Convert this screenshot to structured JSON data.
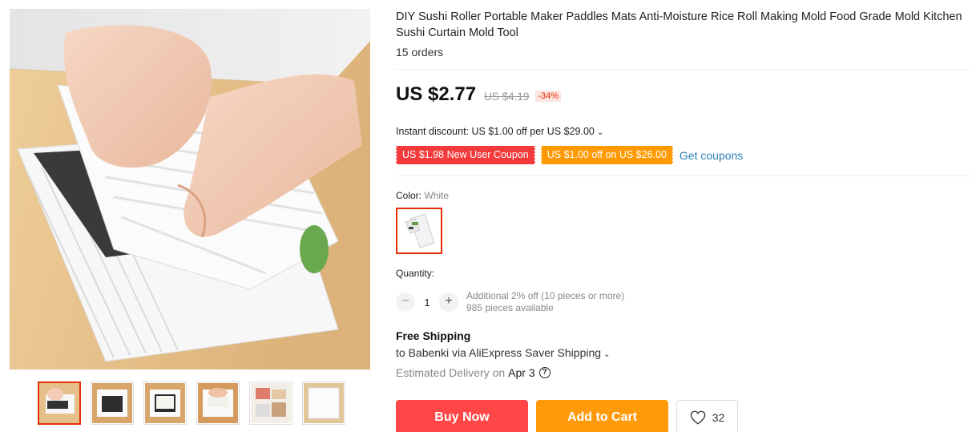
{
  "product": {
    "title": "DIY Sushi Roller Portable Maker Paddles Mats Anti-Moisture Rice Roll Making Mold Food Grade Mold Kitchen Sushi Curtain Mold Tool",
    "orders": "15 orders"
  },
  "price": {
    "current": "US $2.77",
    "original": "US $4.19",
    "discount": "-34%"
  },
  "instant_discount": "Instant discount: US $1.00 off per US $29.00",
  "coupons": {
    "new_user": "US $1.98 New User Coupon",
    "store": "US $1.00 off on US $26.00",
    "get_link": "Get coupons"
  },
  "color": {
    "label": "Color:",
    "selected": "White"
  },
  "quantity": {
    "label": "Quantity:",
    "minus": "−",
    "value": "1",
    "plus": "+",
    "note_line1": "Additional 2% off (10 pieces or more)",
    "note_line2": "985 pieces available"
  },
  "shipping": {
    "title": "Free Shipping",
    "to": "to Babenki via AliExpress Saver Shipping",
    "estimated_label": "Estimated Delivery on",
    "estimated_date": "Apr 3",
    "help_glyph": "?"
  },
  "actions": {
    "buy": "Buy Now",
    "cart": "Add to Cart",
    "wishlist_count": "32"
  },
  "icons": {
    "chevron": "chevron-down-icon",
    "heart": "heart-icon",
    "help": "question-circle-icon"
  },
  "colors": {
    "accent_red": "#ff4747",
    "accent_orange": "#ff9a0b",
    "link_blue": "#2e7fb8",
    "selected_border": "#e62e04"
  }
}
